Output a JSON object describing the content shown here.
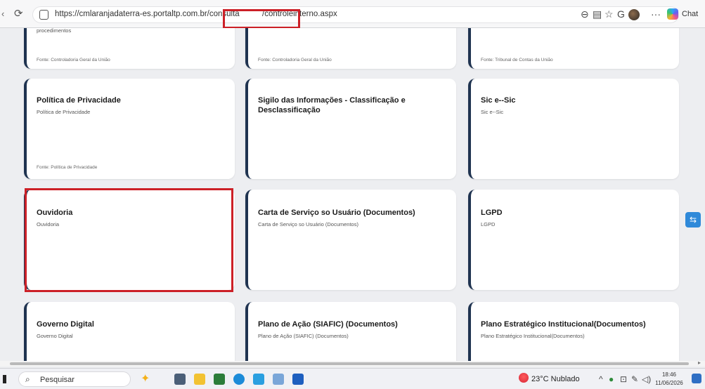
{
  "browser": {
    "url_base": "https://cmlaranjadaterra-es.portaltp.com.br/consulta",
    "url_path": "/controleinterno.aspx",
    "chat_label": "Chat"
  },
  "cards": {
    "row0": [
      {
        "title": "procedimentos",
        "source": "Fonte: Controladoria Geral da União"
      },
      {
        "title": "",
        "source": "Fonte: Controladoria Geral da União"
      },
      {
        "title": "",
        "source": "Fonte: Tribunal de Contas da União"
      }
    ],
    "row1": [
      {
        "title": "Política de Privacidade",
        "subtitle": "Política de Privacidade",
        "source": "Fonte: Política de Privacidade"
      },
      {
        "title": "Sigilo das Informações - Classificação e Desclassificação",
        "subtitle": "",
        "source": ""
      },
      {
        "title": "Sic e--Sic",
        "subtitle": "Sic e--Sic",
        "source": ""
      }
    ],
    "row2": [
      {
        "title": "Ouvidoria",
        "subtitle": "Ouvidoria"
      },
      {
        "title": "Carta de Serviço so Usuário (Documentos)",
        "subtitle": "Carta de Serviço so Usuário (Documentos)"
      },
      {
        "title": "LGPD",
        "subtitle": "LGPD"
      }
    ],
    "row3": [
      {
        "title": "Governo Digital",
        "subtitle": "Governo Digital"
      },
      {
        "title": "Plano de Ação (SIAFIC) (Documentos)",
        "subtitle": "Plano de Ação (SIAFIC) (Documentos)"
      },
      {
        "title": "Plano Estratégico Institucional(Documentos)",
        "subtitle": "Plano Estratégico Institucional(Documentos)"
      }
    ]
  },
  "taskbar": {
    "search_placeholder": "Pesquisar",
    "weather": "23°C  Nublado",
    "time": "18:46",
    "date": "11/06/2026"
  },
  "colors": {
    "highlight": "#cc2027",
    "card_accent": "#1f3350"
  },
  "icons": [
    "reload-icon",
    "lock-icon",
    "zoom-icon",
    "reader-icon",
    "favorite-icon",
    "extension-icon",
    "favorites-icon",
    "more-icon",
    "copilot-icon",
    "search-icon",
    "windows-icon"
  ]
}
